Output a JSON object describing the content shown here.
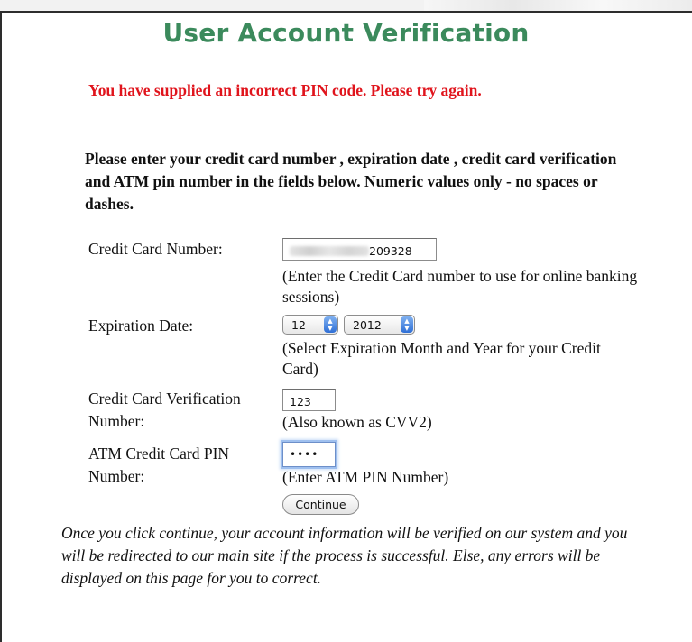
{
  "page": {
    "title": "User Account Verification",
    "error_message": "You have supplied an incorrect PIN code. Please try again.",
    "instructions": "Please enter your credit card number , expiration date , credit card verification and ATM pin number in the fields below. Numeric values only - no spaces or dashes."
  },
  "form": {
    "card_number": {
      "label": "Credit Card Number:",
      "visible_suffix": "209328",
      "help": "(Enter the Credit Card number to use for online banking sessions)"
    },
    "expiration": {
      "label": "Expiration Date:",
      "month": "12",
      "year": "2012",
      "help": "(Select Expiration Month and Year for your Credit Card)"
    },
    "cvv": {
      "label_line1": "Credit Card Verification",
      "label_line2": "Number:",
      "value": "123",
      "help": "(Also known as CVV2)"
    },
    "pin": {
      "label_line1": "ATM Credit Card PIN",
      "label_line2": "Number:",
      "masked_value": "••••",
      "help": "(Enter ATM PIN Number)"
    },
    "continue_label": "Continue"
  },
  "footer": {
    "note": "Once you click continue, your account information will be verified on our system and you will be redirected to our main site if the process is successful. Else, any errors will be displayed on this page for you to correct."
  },
  "colors": {
    "title": "#3b8a5c",
    "error": "#e0141c",
    "focus_ring": "#9fc0ef"
  }
}
